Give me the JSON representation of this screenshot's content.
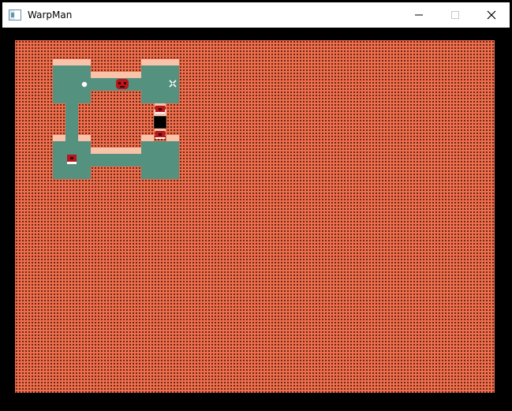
{
  "window": {
    "title": "WarpMan",
    "controls": {
      "minimize_icon": "minimize-icon",
      "maximize_icon": "maximize-icon",
      "close_icon": "close-icon"
    }
  },
  "game": {
    "background_color": "#f06e4c",
    "room_color": "#55917f",
    "ledge_color": "#f8c3a8",
    "entities": [
      {
        "type": "player",
        "icon": "white-dot-icon"
      },
      {
        "type": "enemy",
        "icon": "red-blob-icon"
      },
      {
        "type": "warp-target",
        "icon": "x-marker-icon"
      },
      {
        "type": "treasure-chest",
        "icon": "chest-icon"
      },
      {
        "type": "warp-portal",
        "icon": "black-portal-icon"
      },
      {
        "type": "treasure-chest",
        "icon": "chest-icon"
      },
      {
        "type": "treasure-chest",
        "icon": "chest-icon"
      }
    ]
  }
}
